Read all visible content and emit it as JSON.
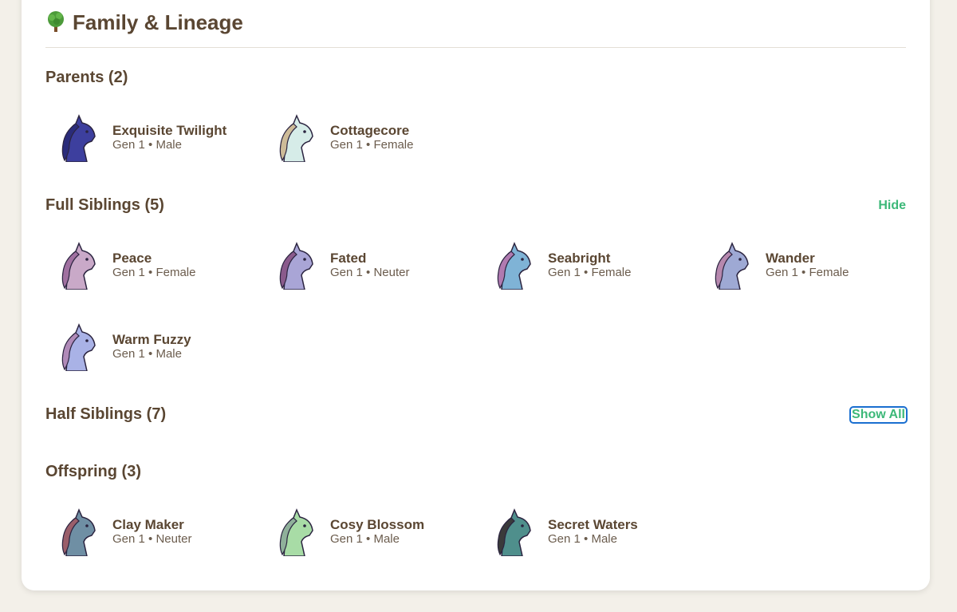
{
  "header": {
    "title": "Family & Lineage",
    "icon": "tree-icon"
  },
  "parents": {
    "title": "Parents (2)",
    "items": [
      {
        "name": "Exquisite Twilight",
        "meta": "Gen 1 • Male",
        "color": "#3d3f9e",
        "mane": "#2a2b7a"
      },
      {
        "name": "Cottagecore",
        "meta": "Gen 1 • Female",
        "color": "#d6ece8",
        "mane": "#cdbb98"
      }
    ]
  },
  "full_siblings": {
    "title": "Full Siblings (5)",
    "toggle": "Hide",
    "items": [
      {
        "name": "Peace",
        "meta": "Gen 1 • Female",
        "color": "#c9a9c8",
        "mane": "#a070a0"
      },
      {
        "name": "Fated",
        "meta": "Gen 1 • Neuter",
        "color": "#a9a5d6",
        "mane": "#8a5a8c"
      },
      {
        "name": "Seabright",
        "meta": "Gen 1 • Female",
        "color": "#7fb3d6",
        "mane": "#b07ab0"
      },
      {
        "name": "Wander",
        "meta": "Gen 1 • Female",
        "color": "#9ea9d4",
        "mane": "#b688ae"
      },
      {
        "name": "Warm Fuzzy",
        "meta": "Gen 1 • Male",
        "color": "#a9b2e6",
        "mane": "#b08ab8"
      }
    ]
  },
  "half_siblings": {
    "title": "Half Siblings (7)",
    "toggle": "Show All"
  },
  "offspring": {
    "title": "Offspring (3)",
    "items": [
      {
        "name": "Clay Maker",
        "meta": "Gen 1 • Neuter",
        "color": "#6f8fa4",
        "mane": "#9a5e6a"
      },
      {
        "name": "Cosy Blossom",
        "meta": "Gen 1 • Male",
        "color": "#a8dca6",
        "mane": "#8fb09a"
      },
      {
        "name": "Secret Waters",
        "meta": "Gen 1 • Male",
        "color": "#4f8f8c",
        "mane": "#3a3a3a"
      }
    ]
  }
}
